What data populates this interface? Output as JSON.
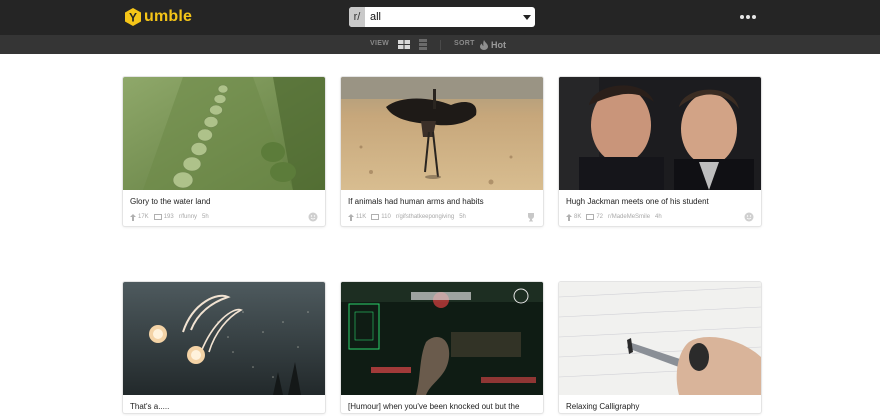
{
  "header": {
    "logo_text": "umble",
    "logo_letter": "Y",
    "subreddit_prefix": "r/",
    "subreddit_value": "all",
    "view_label": "VIEW",
    "sort_label": "SORT",
    "sort_value": "Hot"
  },
  "posts": [
    {
      "title": "Glory to the water land",
      "upvotes": "17K",
      "comments": "193",
      "subreddit": "r/funny",
      "age": "5h"
    },
    {
      "title": "If animals had human arms and habits",
      "upvotes": "11K",
      "comments": "110",
      "subreddit": "r/gifsthatkeepongiving",
      "age": "5h"
    },
    {
      "title": "Hugh Jackman meets one of his student",
      "upvotes": "8K",
      "comments": "72",
      "subreddit": "r/MadeMeSmile",
      "age": "4h"
    },
    {
      "title": "That's a.....",
      "upvotes": "",
      "comments": "",
      "subreddit": "",
      "age": ""
    },
    {
      "title": "[Humour] when you've been knocked out but the",
      "upvotes": "",
      "comments": "",
      "subreddit": "",
      "age": ""
    },
    {
      "title": "Relaxing Calligraphy",
      "upvotes": "",
      "comments": "",
      "subreddit": "",
      "age": ""
    }
  ]
}
